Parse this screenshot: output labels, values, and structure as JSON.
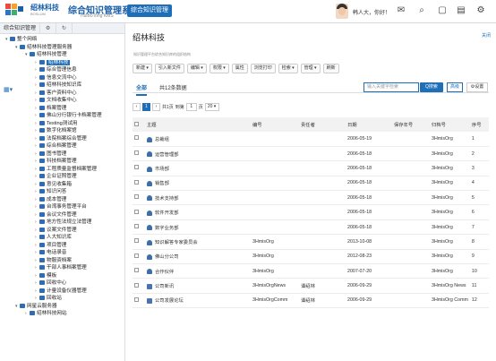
{
  "header": {
    "brand_cn": "绍林科技",
    "brand_en": "BOSLUM",
    "system_title": "综合知识管理系统",
    "system_sub": "HuiBoTong KMS",
    "nav_button": "综合知识管理",
    "greeting": "韩人大，你好！",
    "icons": [
      "mail-icon",
      "search-icon",
      "message-icon",
      "doc-icon",
      "chat-icon",
      "gear-icon"
    ]
  },
  "sidebar": {
    "tab": "综合知识管理",
    "tree": [
      {
        "label": "整个网络",
        "level": 0,
        "arrow": "▾"
      },
      {
        "label": "绍林科技管理服务器",
        "level": 1,
        "arrow": "▾"
      },
      {
        "label": "绍林科技管理",
        "level": 2,
        "arrow": "▾"
      },
      {
        "label": "绍林科技",
        "level": 3,
        "arrow": "›",
        "selected": true
      },
      {
        "label": "综合管理信息",
        "level": 3,
        "arrow": "›"
      },
      {
        "label": "信息交流中心",
        "level": 3,
        "arrow": "›"
      },
      {
        "label": "绍林科技知识库",
        "level": 3,
        "arrow": "›"
      },
      {
        "label": "客户资料中心",
        "level": 3,
        "arrow": "›"
      },
      {
        "label": "文档收集中心",
        "level": 3,
        "arrow": "›"
      },
      {
        "label": "档案管理",
        "level": 3,
        "arrow": "›"
      },
      {
        "label": "佛山分行银行卡档案管理",
        "level": 3,
        "arrow": "›"
      },
      {
        "label": "Testing测试用",
        "level": 3,
        "arrow": "›"
      },
      {
        "label": "数字化档案馆",
        "level": 3,
        "arrow": "›"
      },
      {
        "label": "法院档案综合管理",
        "level": 3,
        "arrow": "›"
      },
      {
        "label": "综合档案管理",
        "level": 3,
        "arrow": "›"
      },
      {
        "label": "图书管理",
        "level": 3,
        "arrow": "›"
      },
      {
        "label": "科技档案管理",
        "level": 3,
        "arrow": "›"
      },
      {
        "label": "工程质量监督档案管理",
        "level": 3,
        "arrow": "›"
      },
      {
        "label": "企业证照管理",
        "level": 3,
        "arrow": "›"
      },
      {
        "label": "意见收集箱",
        "level": 3,
        "arrow": "›"
      },
      {
        "label": "知识问答",
        "level": 3,
        "arrow": "›"
      },
      {
        "label": "成本管理",
        "level": 3,
        "arrow": "›"
      },
      {
        "label": "台湾事务管理平台",
        "level": 3,
        "arrow": "›"
      },
      {
        "label": "会议文件管理",
        "level": 3,
        "arrow": "›"
      },
      {
        "label": "地方性法规立法管理",
        "level": 3,
        "arrow": "›"
      },
      {
        "label": "议案文件管理",
        "level": 3,
        "arrow": "›"
      },
      {
        "label": "人大知识库",
        "level": 3,
        "arrow": "›"
      },
      {
        "label": "项目管理",
        "level": 3,
        "arrow": "›"
      },
      {
        "label": "电话录音",
        "level": 3,
        "arrow": "›"
      },
      {
        "label": "物服资档案",
        "level": 3,
        "arrow": "›"
      },
      {
        "label": "干部人事档案管理",
        "level": 3,
        "arrow": "›"
      },
      {
        "label": "模板",
        "level": 3,
        "arrow": "›"
      },
      {
        "label": "回收中心",
        "level": 3,
        "arrow": "›"
      },
      {
        "label": "计量设备仪器管理",
        "level": 3,
        "arrow": "›"
      },
      {
        "label": "回收站",
        "level": 3,
        "arrow": "›"
      },
      {
        "label": "网星云服务器",
        "level": 1,
        "arrow": "▾"
      },
      {
        "label": "绍林科技网站",
        "level": 2,
        "arrow": "›"
      }
    ]
  },
  "main": {
    "title": "绍林科技",
    "description": "知识管理平台综合知识库的组织结构",
    "close_label": "关闭",
    "toolbar": [
      "新建 ▾",
      "引入新文件",
      "编辑 ▾",
      "权限 ▾",
      "属性",
      "浏览打印",
      "检索 ▾",
      "管理 ▾",
      "刷新"
    ],
    "tabs": {
      "all": "全部",
      "count": "共12条数据"
    },
    "search_placeholder": "输入关键字检索",
    "search_button": "Q搜索",
    "advanced_button": "高级",
    "settings_button": "⚙设置",
    "pager": {
      "prev": "‹",
      "page": "1",
      "next": "›",
      "total_label": "共1页",
      "goto_label": "到第",
      "goto_value": "1",
      "page_unit": "页",
      "size_value": "20 ▾"
    },
    "columns": [
      "主题",
      "编号",
      "责任者",
      "日期",
      "保存年号",
      "归档号",
      "序号"
    ],
    "rows": [
      {
        "icon": "grp",
        "title": "总裁组",
        "code": "",
        "owner": "",
        "date": "2006-05-19",
        "year": "",
        "archive": "3HmisOrg",
        "seq": "1"
      },
      {
        "icon": "grp",
        "title": "运营管理部",
        "code": "",
        "owner": "",
        "date": "2006-05-18",
        "year": "",
        "archive": "3HmisOrg",
        "seq": "2"
      },
      {
        "icon": "grp",
        "title": "市场部",
        "code": "",
        "owner": "",
        "date": "2006-05-18",
        "year": "",
        "archive": "3HmisOrg",
        "seq": "3"
      },
      {
        "icon": "grp",
        "title": "销售部",
        "code": "",
        "owner": "",
        "date": "2006-05-18",
        "year": "",
        "archive": "3HmisOrg",
        "seq": "4"
      },
      {
        "icon": "grp",
        "title": "技术支持部",
        "code": "",
        "owner": "",
        "date": "2006-05-18",
        "year": "",
        "archive": "3HmisOrg",
        "seq": "5"
      },
      {
        "icon": "grp",
        "title": "软件开发部",
        "code": "",
        "owner": "",
        "date": "2006-05-18",
        "year": "",
        "archive": "3HmisOrg",
        "seq": "6"
      },
      {
        "icon": "grp",
        "title": "数字业务部",
        "code": "",
        "owner": "",
        "date": "2006-05-18",
        "year": "",
        "archive": "3HmisOrg",
        "seq": "7"
      },
      {
        "icon": "grp",
        "title": "知识解答专家委员会",
        "code": "3HmisOrg",
        "owner": "",
        "date": "2013-10-08",
        "year": "",
        "archive": "3HmisOrg",
        "seq": "8"
      },
      {
        "icon": "grp",
        "title": "佛山分公司",
        "code": "3HmisOrg",
        "owner": "",
        "date": "2012-08-23",
        "year": "",
        "archive": "3HmisOrg",
        "seq": "9"
      },
      {
        "icon": "grp",
        "title": "合作伙伴",
        "code": "3HmisOrg",
        "owner": "",
        "date": "2007-07-20",
        "year": "",
        "archive": "3HmisOrg",
        "seq": "10"
      },
      {
        "icon": "doc",
        "title": "公司新讯",
        "code": "3HmisOrgNews",
        "owner": "谭绍林",
        "date": "2006-09-29",
        "year": "",
        "archive": "3HmisOrg News",
        "seq": "11"
      },
      {
        "icon": "doc",
        "title": "公司发展论坛",
        "code": "3HmisOrgComm",
        "owner": "谭绍林",
        "date": "2006-09-29",
        "year": "",
        "archive": "3HmisOrg Comm",
        "seq": "12"
      }
    ]
  },
  "colors": {
    "accent": "#1e6fb8",
    "brand": "#1a5fa8"
  }
}
